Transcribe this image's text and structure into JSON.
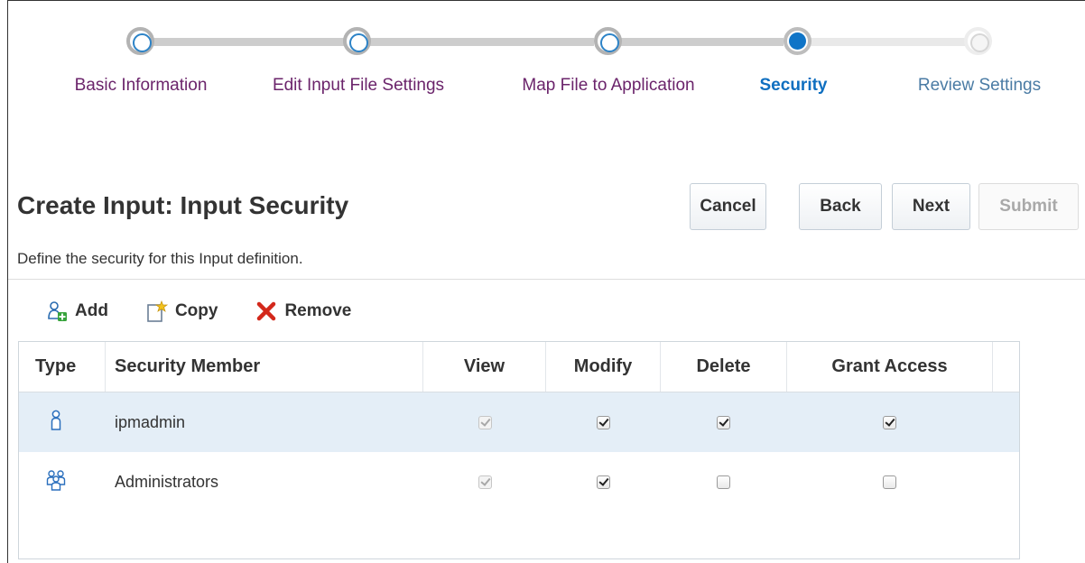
{
  "train": {
    "steps": [
      {
        "label": "Basic Information",
        "state": "visited"
      },
      {
        "label": "Edit Input File Settings",
        "state": "visited"
      },
      {
        "label": "Map File to Application",
        "state": "visited"
      },
      {
        "label": "Security",
        "state": "current"
      },
      {
        "label": "Review Settings",
        "state": "future"
      }
    ]
  },
  "header": {
    "title": "Create Input: Input Security",
    "description": "Define the security for this Input definition."
  },
  "buttons": {
    "cancel": "Cancel",
    "back": "Back",
    "next": "Next",
    "submit": "Submit"
  },
  "toolbar": {
    "add": "Add",
    "copy": "Copy",
    "remove": "Remove"
  },
  "table": {
    "columns": [
      "Type",
      "Security Member",
      "View",
      "Modify",
      "Delete",
      "Grant Access"
    ],
    "rows": [
      {
        "type_icon": "user-icon",
        "member": "ipmadmin",
        "view": true,
        "modify": true,
        "delete": true,
        "grant_access": true,
        "selected": true
      },
      {
        "type_icon": "group-icon",
        "member": "Administrators",
        "view": true,
        "modify": true,
        "delete": false,
        "grant_access": false,
        "selected": false
      }
    ]
  },
  "colors": {
    "visited_link": "#6b246b",
    "current_step": "#0f6fc0",
    "selected_row": "#e4eef7"
  }
}
